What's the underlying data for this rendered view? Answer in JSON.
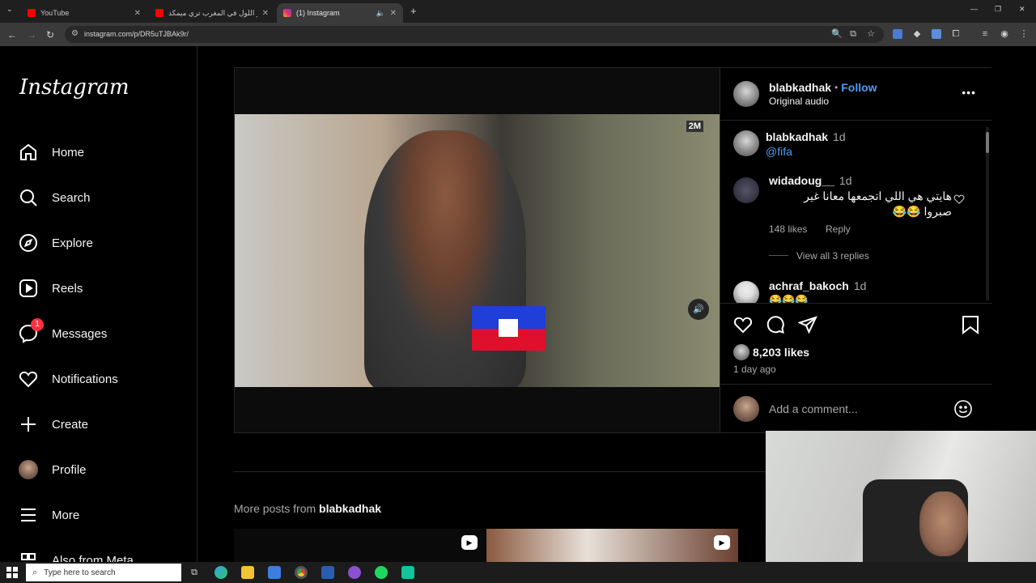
{
  "browser": {
    "tabs": [
      {
        "title": "YouTube",
        "favicon": "youtube-icon",
        "active": false
      },
      {
        "title": "نهار اللول في المغرب تري ميمكد",
        "favicon": "youtube-icon",
        "active": false
      },
      {
        "title": "(1) Instagram",
        "favicon": "instagram-icon",
        "active": true
      }
    ],
    "new_tab_label": "+",
    "url": "instagram.com/p/DR5uTJBAk9r/"
  },
  "sidebar": {
    "logo": "Instagram",
    "items": [
      {
        "label": "Home",
        "icon": "home-icon"
      },
      {
        "label": "Search",
        "icon": "search-icon"
      },
      {
        "label": "Explore",
        "icon": "compass-icon"
      },
      {
        "label": "Reels",
        "icon": "reels-icon"
      },
      {
        "label": "Messages",
        "icon": "messenger-icon",
        "badge": "1"
      },
      {
        "label": "Notifications",
        "icon": "heart-icon"
      },
      {
        "label": "Create",
        "icon": "plus-icon"
      },
      {
        "label": "Profile",
        "icon": "avatar-icon"
      },
      {
        "label": "More",
        "icon": "menu-icon"
      },
      {
        "label": "Also from Meta",
        "icon": "meta-icon"
      }
    ]
  },
  "post": {
    "author": "blabkadhak",
    "separator": "•",
    "follow_label": "Follow",
    "audio": "Original audio",
    "options_label": "•••",
    "video_logo": "2M",
    "comments": [
      {
        "user": "blabkadhak",
        "time": "1d",
        "text": "@fifa"
      },
      {
        "user": "widadoug__",
        "time": "1d",
        "text": "هايتي هي اللي اتجمعها معانا غير صبروا 😂😂",
        "likes": "148 likes",
        "reply_label": "Reply",
        "view_replies": "View all 3 replies"
      },
      {
        "user": "achraf_bakoch",
        "time": "1d",
        "text": "😂😂😂"
      }
    ],
    "likes": "8,203 likes",
    "posted": "1 day ago",
    "add_comment_placeholder": "Add a comment..."
  },
  "more_posts": {
    "prefix": "More posts from",
    "user": "blabkadhak"
  },
  "taskbar": {
    "search_placeholder": "Type here to search"
  },
  "colors": {
    "accent_blue": "#4f9df4",
    "badge_red": "#ff3040",
    "background": "#000000"
  }
}
